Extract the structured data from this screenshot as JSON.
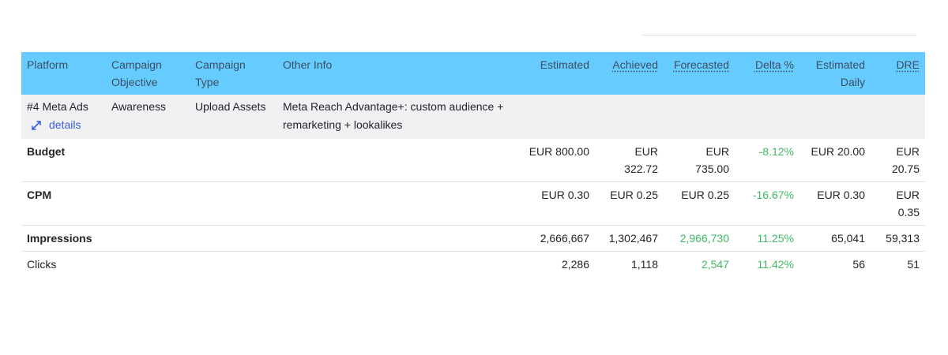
{
  "columns": {
    "platform": "Platform",
    "objective": "Campaign Objective",
    "type": "Campaign Type",
    "other": "Other Info",
    "estimated": "Estimated",
    "achieved": "Achieved",
    "forecasted": "Forecasted",
    "delta": "Delta %",
    "est_daily": "Estimated Daily",
    "dre": "DRE"
  },
  "campaign": {
    "platform": "#4 Meta Ads",
    "details_label": "details",
    "details_icon": "expand-arrows-icon",
    "objective": "Awareness",
    "type": "Upload Assets",
    "other": "Meta Reach Advantage+: custom audience + remarketing + lookalikes"
  },
  "metrics": [
    {
      "label": "Budget",
      "estimated": "EUR 800.00",
      "achieved": "EUR 322.72",
      "forecasted": "EUR 735.00",
      "delta": "-8.12%",
      "est_daily": "EUR 20.00",
      "dre": "EUR 20.75"
    },
    {
      "label": "CPM",
      "estimated": "EUR 0.30",
      "achieved": "EUR 0.25",
      "forecasted": "EUR 0.25",
      "delta": "-16.67%",
      "est_daily": "EUR 0.30",
      "dre": "EUR 0.35"
    },
    {
      "label": "Impressions",
      "estimated": "2,666,667",
      "achieved": "1,302,467",
      "forecasted": "2,966,730",
      "delta": "11.25%",
      "est_daily": "65,041",
      "dre": "59,313"
    },
    {
      "label": "Clicks",
      "estimated": "2,286",
      "achieved": "1,118",
      "forecasted": "2,547",
      "delta": "11.42%",
      "est_daily": "56",
      "dre": "51"
    }
  ],
  "colors": {
    "header_bg": "#66ccff",
    "info_row_bg": "#f1f1f3",
    "positive": "#3fb964",
    "link": "#3d5bd6"
  }
}
